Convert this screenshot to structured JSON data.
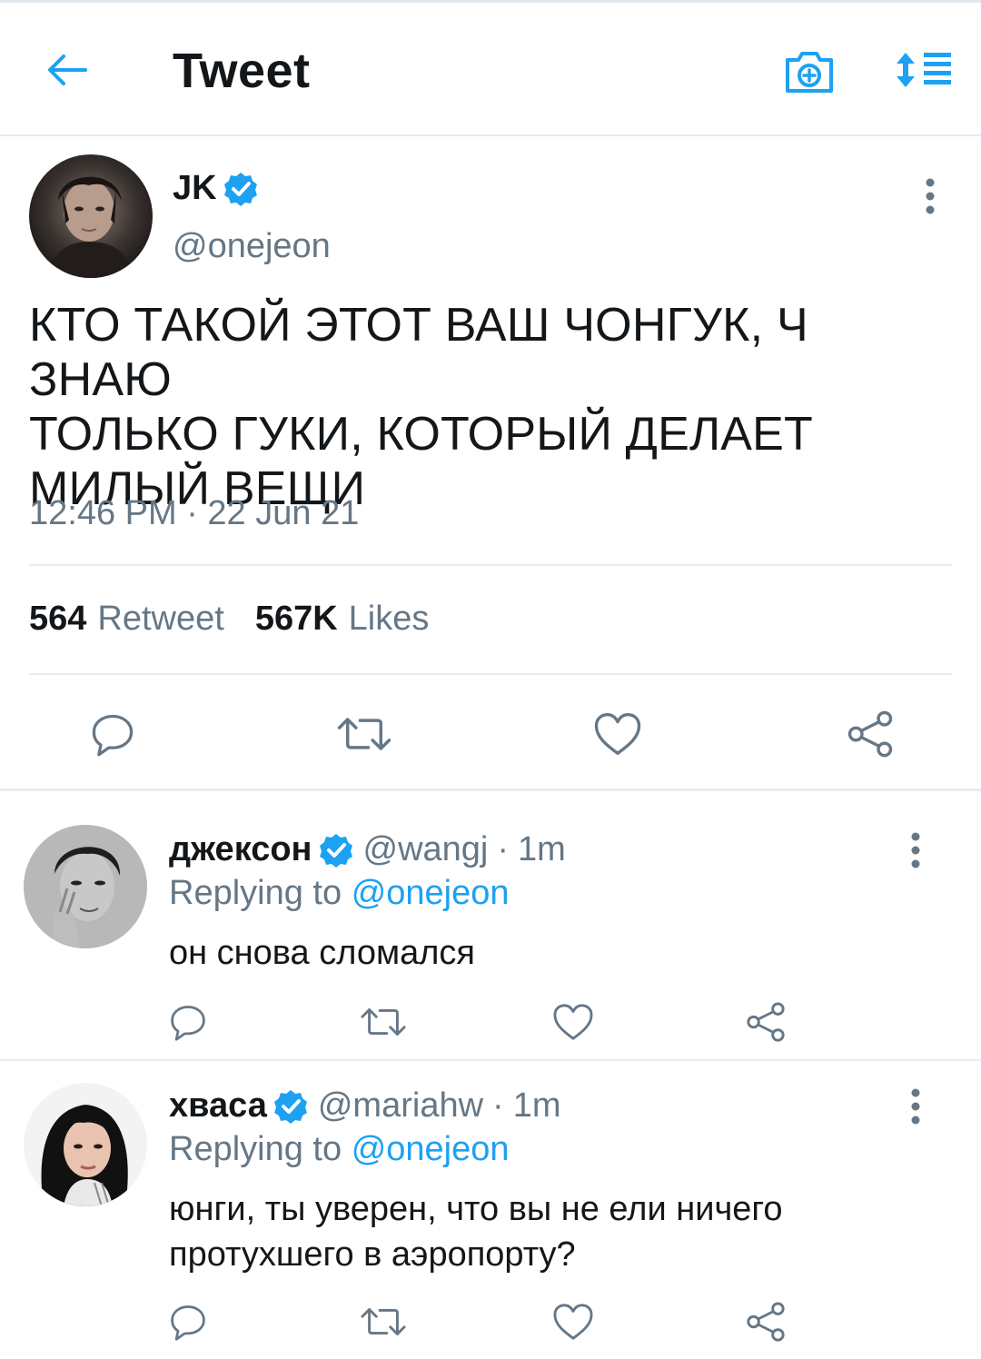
{
  "header": {
    "title": "Tweet",
    "icons": [
      "back-arrow-icon",
      "camera-icon",
      "sort-icon"
    ],
    "accent_color": "#1da1f2"
  },
  "tweet": {
    "author_name": "JK",
    "author_handle": "@onejeon",
    "verified": true,
    "text_lines": [
      "КТО ТАКОЙ ЭТОТ ВАШ ЧОНГУК, Ч ЗНАЮ",
      "ТОЛЬКО ГУКИ, КОТОРЫЙ ДЕЛАЕТ",
      "МИЛЫЙ ВЕЩИ"
    ],
    "timestamp": "12:46 PM · 22 Jun 21",
    "retweets_count": "564",
    "retweets_label": "Retweet",
    "likes_count": "567K",
    "likes_label": "Likes"
  },
  "replies": [
    {
      "name": "джексон",
      "handle": "@wangj",
      "separator": "·",
      "time": "1m",
      "replying_prefix": "Replying to",
      "replying_to": "@onejeon",
      "text_lines": [
        "он снова сломался"
      ]
    },
    {
      "name": "хваса",
      "handle": "@mariahw",
      "separator": "·",
      "time": "1m",
      "replying_prefix": "Replying to",
      "replying_to": "@onejeon",
      "text_lines": [
        "юнги, ты уверен, что вы не ели ничего",
        "протухшего в аэропорту?"
      ]
    }
  ],
  "action_icons": [
    "reply-icon",
    "retweet-icon",
    "like-icon",
    "share-icon"
  ],
  "colors": {
    "text_primary": "#14171a",
    "text_secondary": "#657786",
    "link": "#1da1f2",
    "verified": "#1da1f2",
    "divider": "#e6ecf0"
  }
}
